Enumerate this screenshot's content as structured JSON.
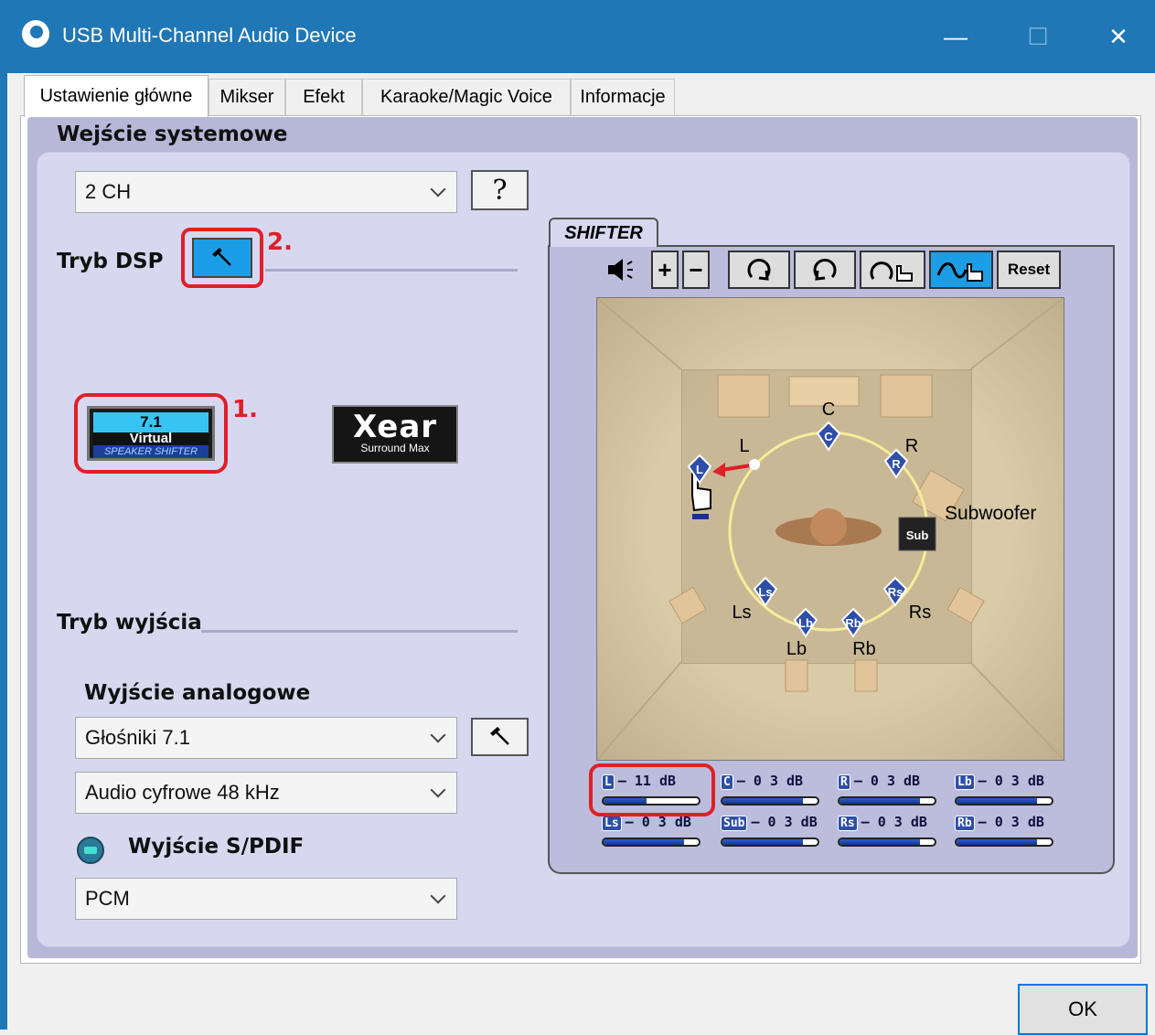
{
  "window": {
    "title": "USB Multi-Channel Audio Device",
    "minimize_label": "—",
    "maximize_label": "☐",
    "close_label": "✕"
  },
  "tabs": [
    {
      "label": "Ustawienie główne",
      "active": true
    },
    {
      "label": "Mikser"
    },
    {
      "label": "Efekt"
    },
    {
      "label": "Karaoke/Magic Voice"
    },
    {
      "label": "Informacje"
    }
  ],
  "system_input": {
    "title": "Wejście systemowe",
    "channels_value": "2 CH",
    "help_label": "?"
  },
  "dsp": {
    "label": "Tryb DSP",
    "annotation": "2.",
    "options": {
      "virtual71": {
        "line1": "7.1",
        "line2": "Virtual",
        "line3": "SPEAKER SHIFTER",
        "annotation": "1."
      },
      "xear": {
        "name": "Xear",
        "sub": "Surround Max"
      }
    }
  },
  "output": {
    "title": "Tryb wyjścia",
    "analog_title": "Wyjście analogowe",
    "speakers_value": "Głośniki 7.1",
    "digital_value": "Audio cyfrowe 48 kHz",
    "spdif_title": "Wyjście S/PDIF",
    "spdif_value": "PCM"
  },
  "shifter": {
    "tab_label": "SHIFTER",
    "plus_label": "+",
    "minus_label": "−",
    "reset_label": "Reset",
    "room_labels": {
      "C": "C",
      "L": "L",
      "R": "R",
      "Subwoofer": "Subwoofer",
      "Ls": "Ls",
      "Rs": "Rs",
      "Lb": "Lb",
      "Rb": "Rb"
    },
    "badges": {
      "L": "L",
      "C": "C",
      "R": "R",
      "Sub": "Sub",
      "Ls": "Ls",
      "Rs": "Rs",
      "Lb": "Lb",
      "Rb": "Rb"
    },
    "levels": [
      {
        "ch": "L",
        "db": "– 11 dB",
        "fill": 0.45
      },
      {
        "ch": "C",
        "db": "– 0 3 dB",
        "fill": 0.85
      },
      {
        "ch": "R",
        "db": "– 0 3 dB",
        "fill": 0.85
      },
      {
        "ch": "Lb",
        "db": "– 0 3 dB",
        "fill": 0.85
      },
      {
        "ch": "Ls",
        "db": "– 0 3 dB",
        "fill": 0.85
      },
      {
        "ch": "Sub",
        "db": "– 0 3 dB",
        "fill": 0.85
      },
      {
        "ch": "Rs",
        "db": "– 0 3 dB",
        "fill": 0.85
      },
      {
        "ch": "Rb",
        "db": "– 0 3 dB",
        "fill": 0.85
      }
    ]
  },
  "ok_label": "OK",
  "colors": {
    "accent": "#1f77b6",
    "annotation": "#e01f28",
    "active_tool": "#1c9ee6"
  }
}
